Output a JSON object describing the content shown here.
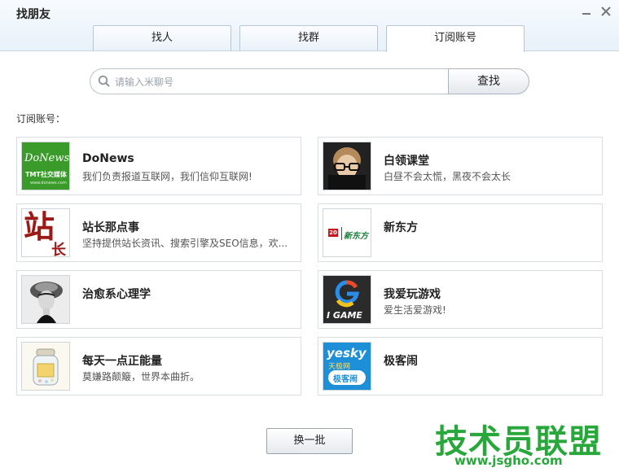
{
  "window": {
    "title": "找朋友",
    "minimize_icon": "minimize-icon",
    "close_icon": "close-icon"
  },
  "tabs": [
    {
      "label": "找人",
      "active": false
    },
    {
      "label": "找群",
      "active": false
    },
    {
      "label": "订阅账号",
      "active": true
    }
  ],
  "search": {
    "placeholder": "请输入米聊号",
    "button_label": "查找",
    "icon": "search-icon"
  },
  "section_label": "订阅账号：",
  "accounts": [
    {
      "name": "DoNews",
      "desc": "我们负责报道互联网，我们信仰互联网!",
      "avatar_text": "DoNews",
      "avatar_sub": "TMT社交媒体",
      "avatar_foot": "www.donews.com"
    },
    {
      "name": "白领课堂",
      "desc": "白昼不会太慌，黑夜不会太长",
      "avatar": "portrait-with-glasses"
    },
    {
      "name": "站长那点事",
      "desc": "坚持提供站长资讯、搜索引擎及SEO信息，欢...",
      "avatar_text": "站",
      "avatar_sub": "长"
    },
    {
      "name": "新东方",
      "desc": "",
      "avatar_text": "新东方",
      "avatar_badge": "20"
    },
    {
      "name": "治愈系心理学",
      "desc": "",
      "avatar": "woman-portrait-bw"
    },
    {
      "name": "我爱玩游戏",
      "desc": "爱生活爱游戏!",
      "avatar_text": "I GAME"
    },
    {
      "name": "每天一点正能量",
      "desc": "莫嫌路颠簸，世界本曲折。",
      "avatar": "jar-illustration"
    },
    {
      "name": "极客闹",
      "desc": "",
      "avatar_text": "yesky",
      "avatar_sub": "天极网",
      "avatar_foot": "极客闹"
    }
  ],
  "refresh_label": "换一批",
  "watermark": {
    "text": "技术员联盟",
    "url": "www.jsgho.com"
  },
  "colors": {
    "accent_green": "#28a73b",
    "donews_green": "#3a9b2a",
    "zhanzhang_red": "#9b1a16"
  }
}
